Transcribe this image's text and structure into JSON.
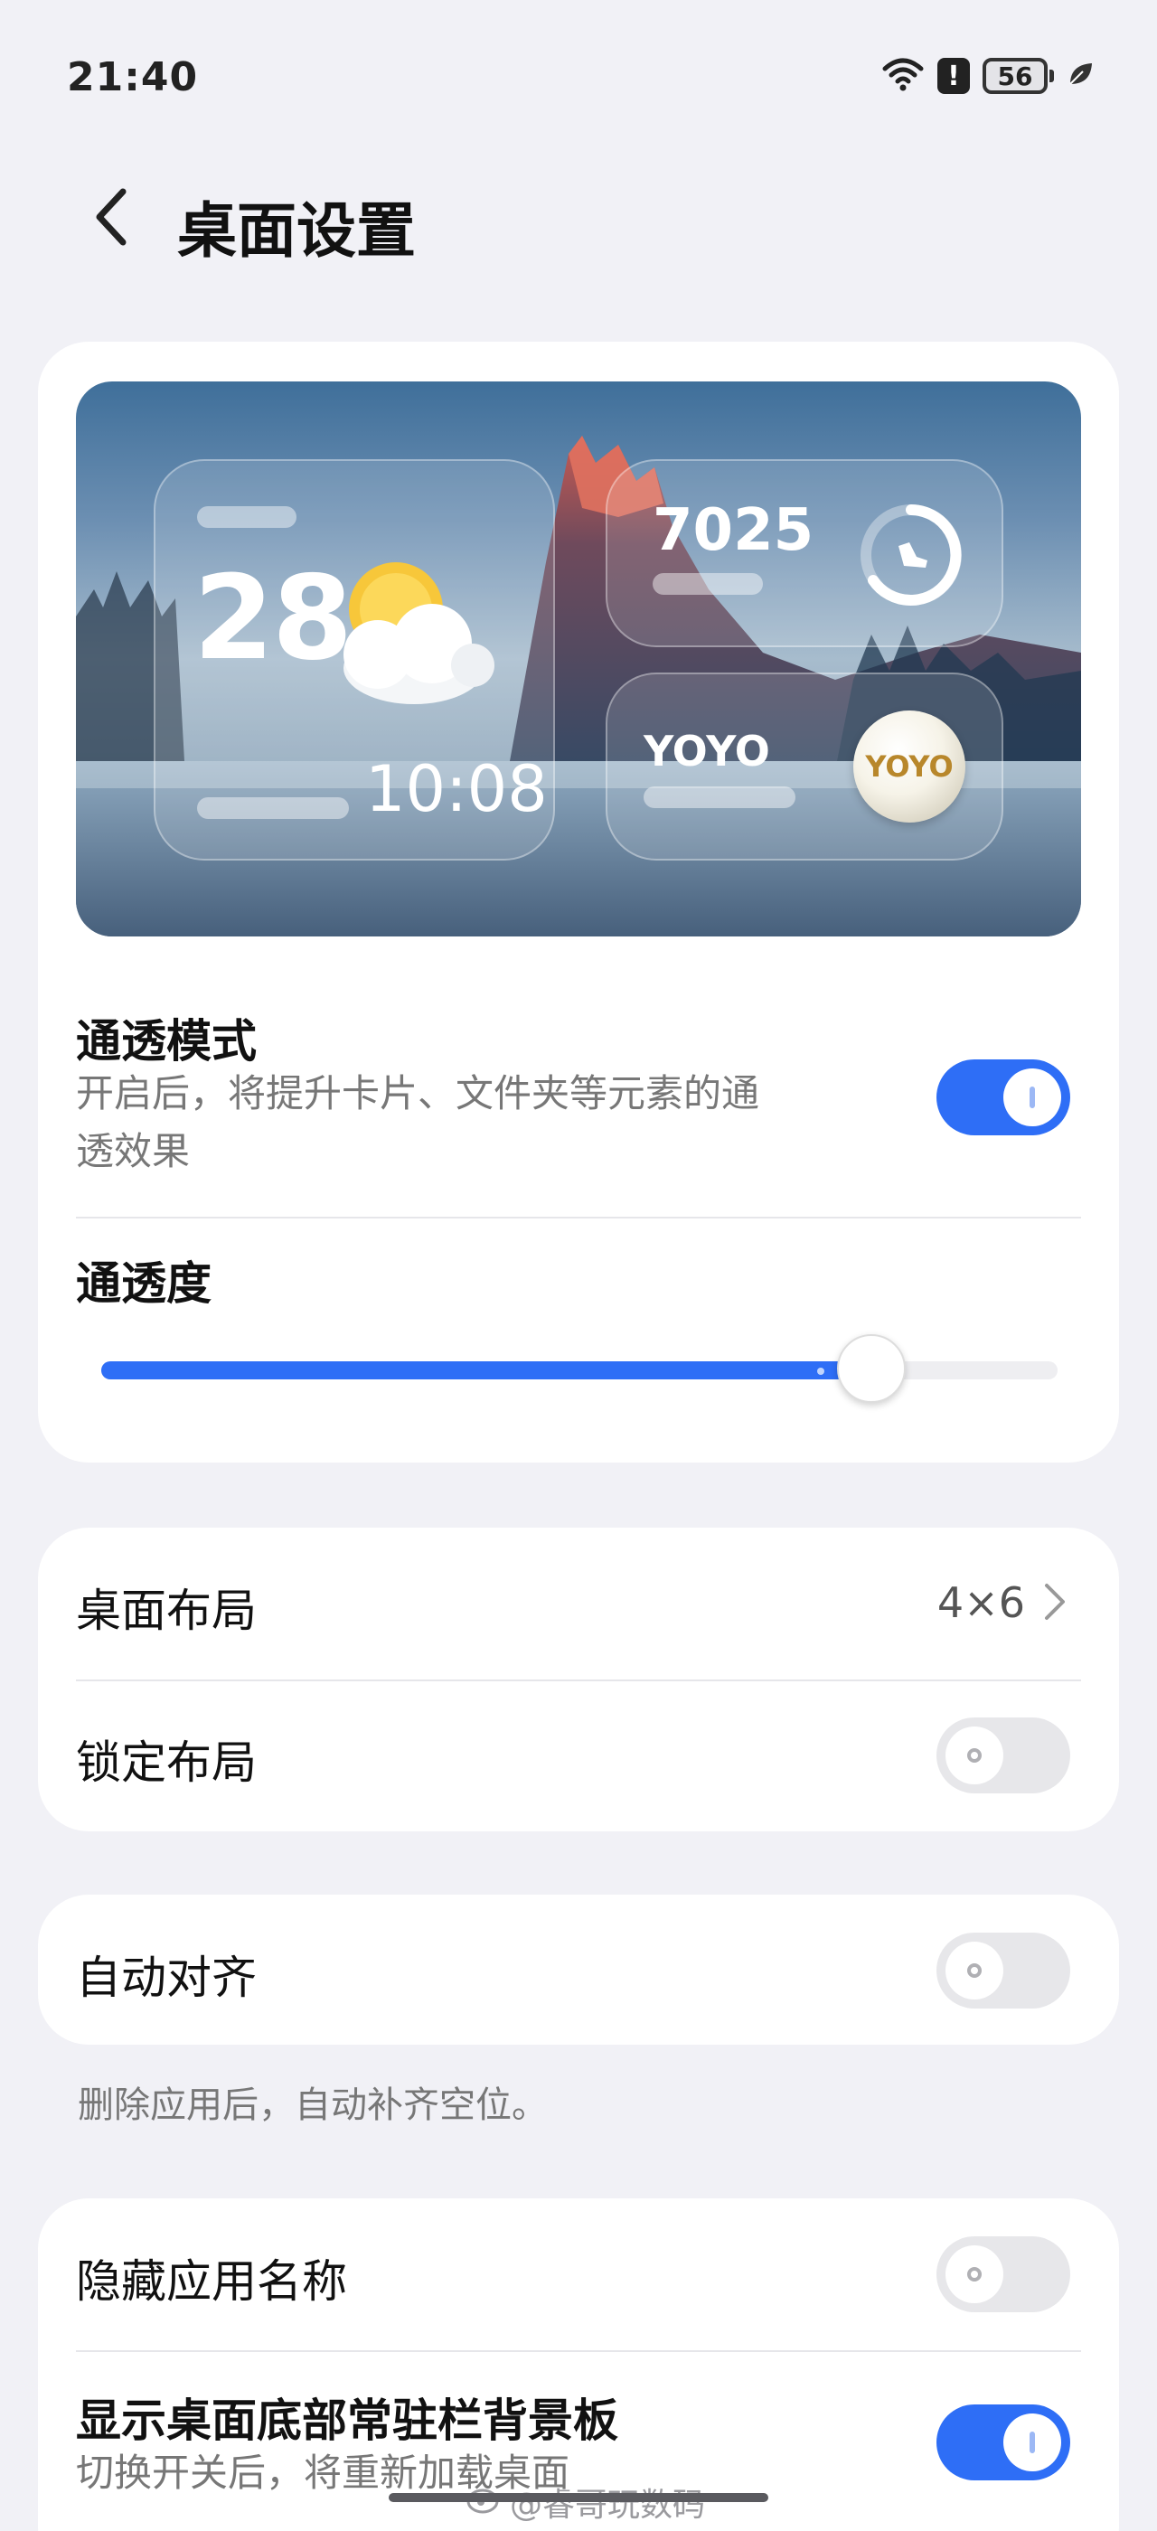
{
  "status": {
    "time": "21:40",
    "battery": "56",
    "alert": "!"
  },
  "header": {
    "title": "桌面设置"
  },
  "preview": {
    "weather": {
      "temp": "28°",
      "time": "10:08"
    },
    "steps": {
      "count": "7025"
    },
    "yoyo": {
      "label": "YOYO",
      "ball_text": "YOYO"
    }
  },
  "transparency_mode": {
    "title": "通透模式",
    "desc_line1": "开启后，将提升卡片、文件夹等元素的通",
    "desc_line2": "透效果",
    "enabled": true
  },
  "transparency_level": {
    "title": "通透度",
    "value_fraction": 0.805
  },
  "layout": {
    "desktop_layout": {
      "title": "桌面布局",
      "value": "4×6"
    },
    "lock_layout": {
      "title": "锁定布局",
      "enabled": false
    }
  },
  "auto_align": {
    "title": "自动对齐",
    "enabled": false,
    "note": "删除应用后，自动补齐空位。"
  },
  "hide_names": {
    "title": "隐藏应用名称",
    "enabled": false
  },
  "dock_bg": {
    "title": "显示桌面底部常驻栏背景板",
    "desc": "切换开关后，将重新加载桌面",
    "enabled": true
  },
  "watermark": "@睿哥玩数码",
  "colors": {
    "accent": "#2e6ef6",
    "background": "#f1f1f6",
    "card": "#ffffff"
  }
}
